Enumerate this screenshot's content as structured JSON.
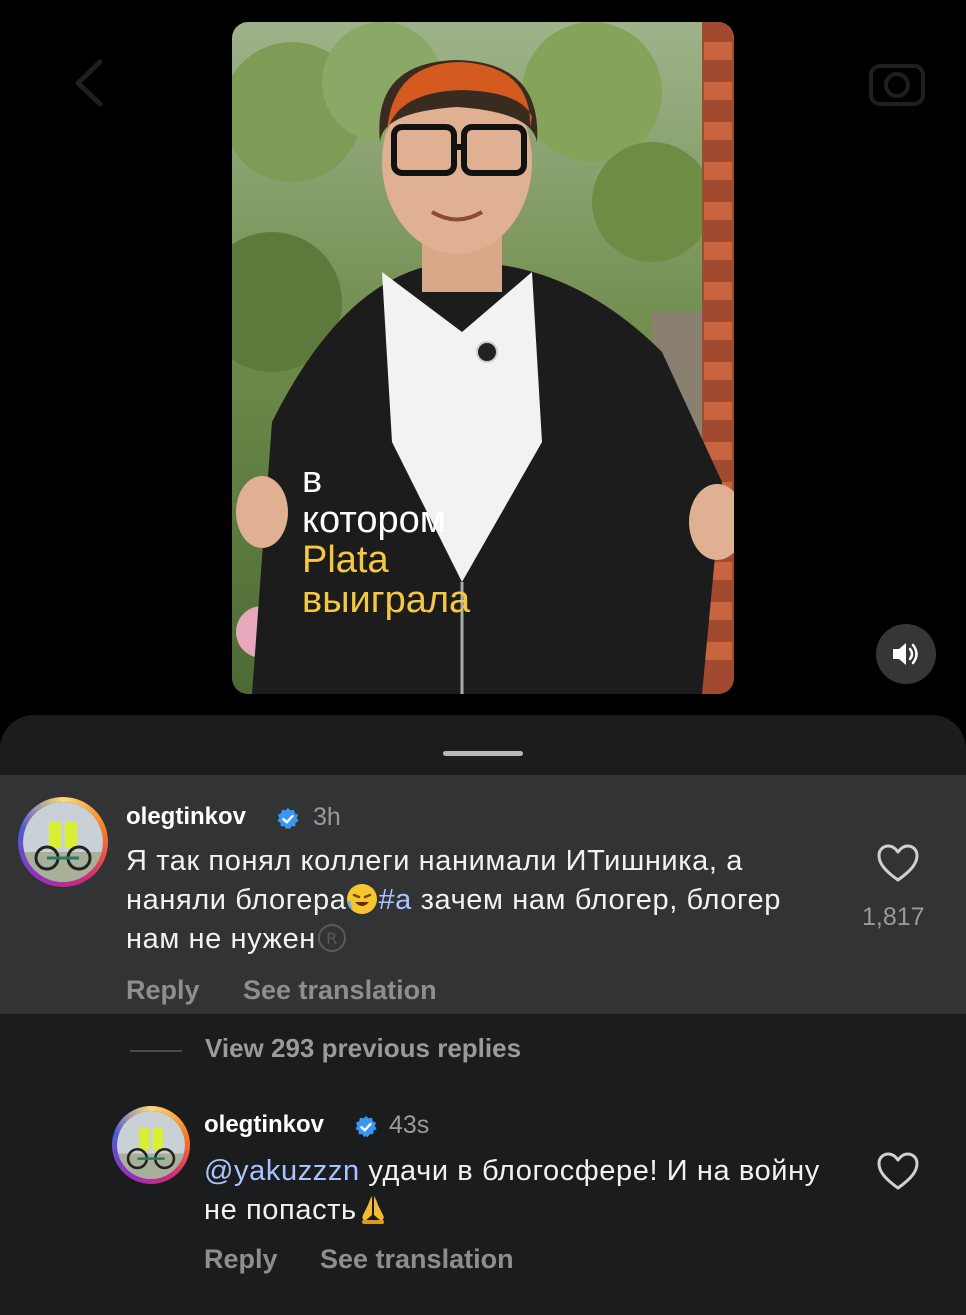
{
  "video": {
    "caption_line1": "в",
    "caption_line2": "котором",
    "caption_line3": "Plata",
    "caption_line4": "выиграла"
  },
  "icons": {
    "back": "back-arrow-icon",
    "camera": "camera-icon",
    "sound": "speaker-icon",
    "like": "heart-icon",
    "verified": "verified-badge-icon"
  },
  "colors": {
    "sheet_bg": "#1b1c1e",
    "highlight_bg": "#323335",
    "verified_blue": "#3897f0",
    "link_blue": "#a8c3ff",
    "muted": "#9a9a9a"
  },
  "comment": {
    "username": "olegtinkov",
    "time": "3h",
    "text_part1": "Я так понял коллеги нанимали ИТишника, а наняли блогера",
    "hashtag": "#а",
    "text_part2": " зачем нам блогер, блогер нам не нужен",
    "likes": "1,817",
    "reply_label": "Reply",
    "translate_label": "See translation"
  },
  "view_replies": "View 293 previous replies",
  "reply": {
    "username": "olegtinkov",
    "time": "43s",
    "mention": "@yakuzzzn",
    "text_part1": " удачи в блогосфере! И на войну не попасть",
    "reply_label": "Reply",
    "translate_label": "See translation"
  }
}
